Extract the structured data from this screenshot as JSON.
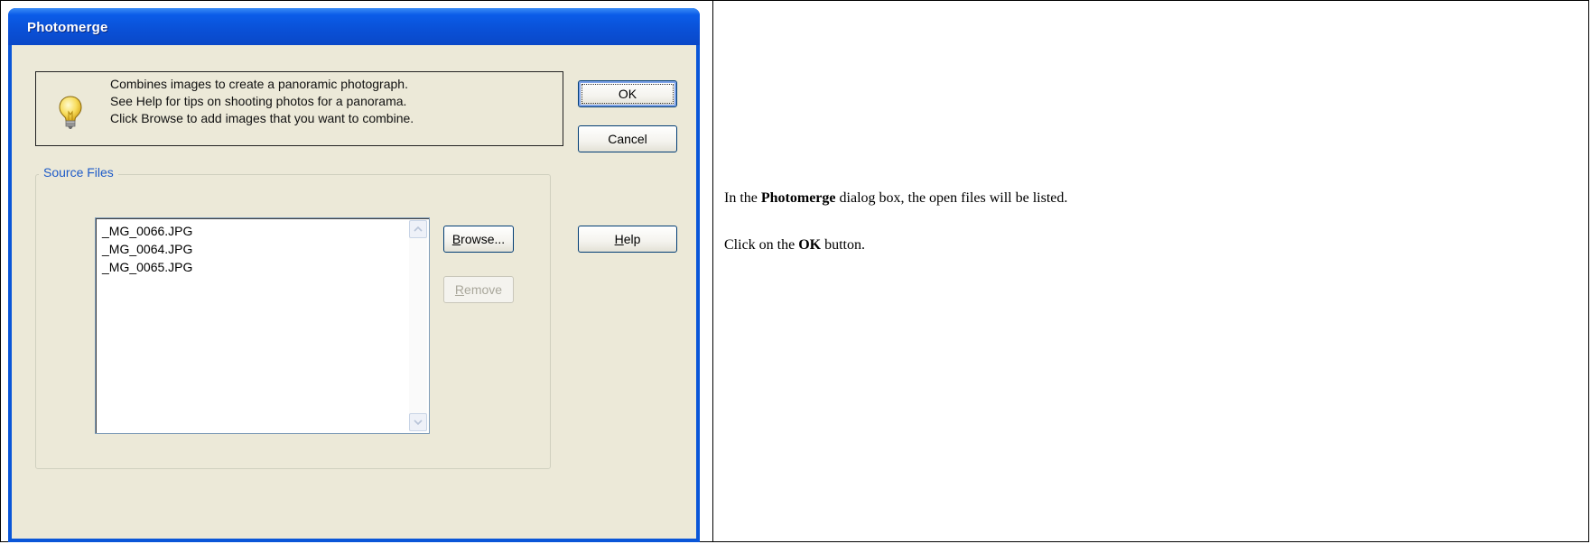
{
  "dialog": {
    "title": "Photomerge",
    "info_lines": [
      "Combines images to create a panoramic photograph.",
      "See Help for tips on shooting photos for a panorama.",
      "Click Browse to add images that you want to combine."
    ],
    "buttons": {
      "ok": "OK",
      "cancel": "Cancel",
      "help_first": "H",
      "help_rest": "elp",
      "browse_first": "B",
      "browse_rest": "rowse...",
      "remove_first": "R",
      "remove_rest": "emove"
    },
    "group_label": "Source Files",
    "files": [
      "_MG_0066.JPG",
      "_MG_0064.JPG",
      "_MG_0065.JPG"
    ],
    "icons": {
      "bulb": "lightbulb-icon",
      "scroll_up": "scroll-up-icon",
      "scroll_down": "scroll-down-icon"
    },
    "colors": {
      "titlebar": "#0a56d8",
      "dialog_bg": "#ece9d8",
      "group_label": "#1d5ac8"
    }
  },
  "caption": {
    "line1_pre": "In the ",
    "line1_bold": "Photomerge",
    "line1_post": " dialog box, the open files will be listed.",
    "line2_pre": "Click on the ",
    "line2_bold": "OK",
    "line2_post": " button."
  }
}
